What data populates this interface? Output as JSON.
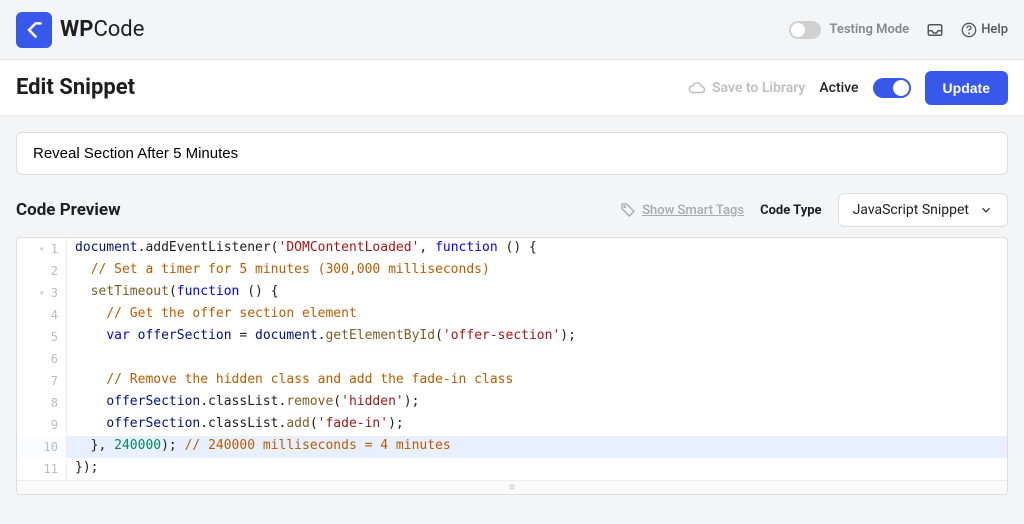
{
  "header": {
    "logo_text": "WP",
    "logo_text_light": "Code",
    "testing_label": "Testing Mode",
    "help_label": "Help"
  },
  "actionbar": {
    "title": "Edit Snippet",
    "save_library": "Save to Library",
    "active_label": "Active",
    "update_label": "Update"
  },
  "snippet": {
    "title_value": "Reveal Section After 5 Minutes"
  },
  "preview": {
    "title": "Code Preview",
    "smart_tags": "Show Smart Tags",
    "code_type_label": "Code Type",
    "selected_type": "JavaScript Snippet"
  },
  "code": {
    "lines": [
      {
        "num": 1,
        "fold": "▾",
        "hl": false,
        "t": [
          [
            "v",
            "document"
          ],
          [
            "p",
            ".addEventListener("
          ],
          [
            "s",
            "'DOMContentLoaded'"
          ],
          [
            "p",
            ", "
          ],
          [
            "k",
            "function"
          ],
          [
            "p",
            " () {"
          ]
        ]
      },
      {
        "num": 2,
        "fold": "",
        "hl": false,
        "t": [
          [
            "p",
            "  "
          ],
          [
            "c",
            "// Set a timer for 5 minutes (300,000 milliseconds)"
          ]
        ]
      },
      {
        "num": 3,
        "fold": "▾",
        "hl": false,
        "t": [
          [
            "p",
            "  "
          ],
          [
            "f",
            "setTimeout"
          ],
          [
            "p",
            "("
          ],
          [
            "k",
            "function"
          ],
          [
            "p",
            " () {"
          ]
        ]
      },
      {
        "num": 4,
        "fold": "",
        "hl": false,
        "t": [
          [
            "p",
            "    "
          ],
          [
            "c",
            "// Get the offer section element"
          ]
        ]
      },
      {
        "num": 5,
        "fold": "",
        "hl": false,
        "t": [
          [
            "p",
            "    "
          ],
          [
            "k",
            "var"
          ],
          [
            "p",
            " "
          ],
          [
            "v",
            "offerSection"
          ],
          [
            "p",
            " = "
          ],
          [
            "v",
            "document"
          ],
          [
            "p",
            "."
          ],
          [
            "f",
            "getElementById"
          ],
          [
            "p",
            "("
          ],
          [
            "s",
            "'offer-section'"
          ],
          [
            "p",
            ");"
          ]
        ]
      },
      {
        "num": 6,
        "fold": "",
        "hl": false,
        "t": [
          [
            "p",
            " "
          ]
        ]
      },
      {
        "num": 7,
        "fold": "",
        "hl": false,
        "t": [
          [
            "p",
            "    "
          ],
          [
            "c",
            "// Remove the hidden class and add the fade-in class"
          ]
        ]
      },
      {
        "num": 8,
        "fold": "",
        "hl": false,
        "t": [
          [
            "p",
            "    "
          ],
          [
            "v",
            "offerSection"
          ],
          [
            "p",
            ".classList."
          ],
          [
            "f",
            "remove"
          ],
          [
            "p",
            "("
          ],
          [
            "s",
            "'hidden'"
          ],
          [
            "p",
            ");"
          ]
        ]
      },
      {
        "num": 9,
        "fold": "",
        "hl": false,
        "t": [
          [
            "p",
            "    "
          ],
          [
            "v",
            "offerSection"
          ],
          [
            "p",
            ".classList."
          ],
          [
            "f",
            "add"
          ],
          [
            "p",
            "("
          ],
          [
            "s",
            "'fade-in'"
          ],
          [
            "p",
            ");"
          ]
        ]
      },
      {
        "num": 10,
        "fold": "",
        "hl": true,
        "t": [
          [
            "p",
            "  }, "
          ],
          [
            "n",
            "240000"
          ],
          [
            "p",
            "); "
          ],
          [
            "c",
            "// 240000 milliseconds = 4 minutes"
          ]
        ]
      },
      {
        "num": 11,
        "fold": "",
        "hl": false,
        "t": [
          [
            "p",
            "});"
          ]
        ]
      }
    ]
  }
}
